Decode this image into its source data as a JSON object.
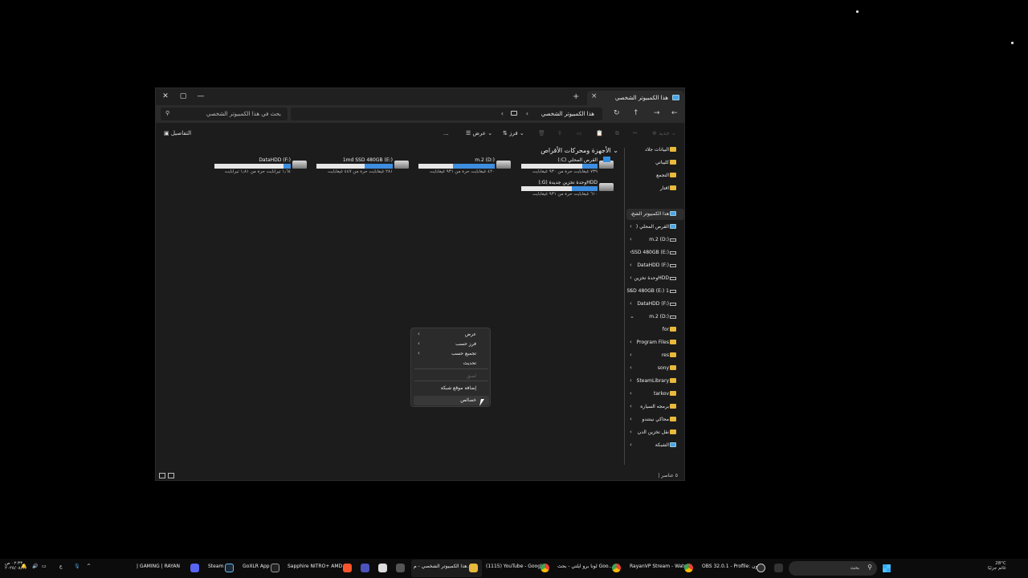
{
  "window": {
    "tab_title": "هذا الكمبيوتر الشخصي",
    "new_tab": "+",
    "breadcrumb": "هذا الكمبيوتر الشخصي",
    "search_placeholder": "بحث في هذا الكمبيوتر الشخصي",
    "details_label": "التفاصيل",
    "cmd": {
      "new_label": "جديد",
      "sort_label": "فرز",
      "view_label": "عرض",
      "more_label": "..."
    },
    "status_text": "٥ عناصر"
  },
  "content": {
    "group_header": "الأجهزة ومحركات الأقراص",
    "drives": [
      {
        "name": "القرص المحلي (C:)",
        "free": "٧٣٩ غيغابايت حرة من ٩٣٠ غيغابايت",
        "used_fraction": 0.2,
        "icon": "windows-drive-icon"
      },
      {
        "name": "m.2 (D:)",
        "free": "٤٢٠ غيغابايت حرة من ٩٣١ غيغابايت",
        "used_fraction": 0.55,
        "icon": "drive-icon"
      },
      {
        "name": "1md SSD 480GB (E:)",
        "free": "٢٨١ غيغابايت حرة من ٤٤٧ غيغابايت",
        "used_fraction": 0.37,
        "icon": "drive-icon"
      },
      {
        "name": "DataHDD (F:)",
        "free": "١٫٦٤ تيرابايت حرة من ١٫٨١ تيرابايت",
        "used_fraction": 0.1,
        "icon": "drive-icon"
      },
      {
        "name": "HDDوحدة تخزين جديدة (G:)",
        "free": "٦١٠ غيغابايت حرة من ٩٣١ غيغابايت",
        "used_fraction": 0.34,
        "icon": "drive-icon"
      }
    ]
  },
  "navpane": {
    "items": [
      {
        "label": "البيانات جلاد",
        "type": "folder",
        "chevron": ""
      },
      {
        "label": "كليباتي",
        "type": "folder",
        "chevron": ""
      },
      {
        "label": "التجمع",
        "type": "folder",
        "chevron": ""
      },
      {
        "label": "افتار",
        "type": "folder",
        "chevron": ""
      },
      {
        "label": "هذا الكمبيوتر الشخ",
        "type": "pc",
        "chevron": "⌄"
      },
      {
        "label": "القرص المحلي (",
        "type": "windrive",
        "chevron": "›"
      },
      {
        "label": "m.2 (D:)",
        "type": "drive",
        "chevron": "›"
      },
      {
        "label": "SSD 480GB (E:)",
        "type": "drive",
        "chevron": "›"
      },
      {
        "label": "DataHDD (F:)",
        "type": "drive",
        "chevron": "›"
      },
      {
        "label": "HDDوحدة تخزين",
        "type": "drive",
        "chevron": "›"
      },
      {
        "label": "SSD 480GB (E:) 1",
        "type": "drive",
        "chevron": "›"
      },
      {
        "label": "DataHDD (F:)",
        "type": "drive",
        "chevron": "›"
      },
      {
        "label": "m.2 (D:)",
        "type": "drive",
        "chevron": "⌄"
      },
      {
        "label": "for",
        "type": "folder",
        "chevron": ""
      },
      {
        "label": "Program Files",
        "type": "folder",
        "chevron": "›"
      },
      {
        "label": "res",
        "type": "folder",
        "chevron": "›"
      },
      {
        "label": "sony",
        "type": "folder",
        "chevron": "›"
      },
      {
        "label": "SteamLibrary",
        "type": "folder",
        "chevron": "›"
      },
      {
        "label": "tarkov",
        "type": "folder",
        "chevron": "›"
      },
      {
        "label": "برمجه السياره",
        "type": "folder",
        "chevron": "›"
      },
      {
        "label": "محاكي نينتندو",
        "type": "folder",
        "chevron": "›"
      },
      {
        "label": "نقل تخزين الدن",
        "type": "folder",
        "chevron": "›"
      },
      {
        "label": "الشبكة",
        "type": "network",
        "chevron": "›"
      }
    ]
  },
  "context_menu": {
    "items": [
      {
        "label": "عرض",
        "submenu": true,
        "disabled": false
      },
      {
        "label": "فرز حسب",
        "submenu": true,
        "disabled": false
      },
      {
        "label": "تجميع حسب",
        "submenu": true,
        "disabled": false
      },
      {
        "label": "تحديث",
        "submenu": false,
        "disabled": false
      },
      {
        "label": "لصق",
        "submenu": false,
        "disabled": true
      },
      {
        "label": "إضافة موقع شبكة",
        "submenu": false,
        "disabled": false
      },
      {
        "label": "خصائص",
        "submenu": false,
        "disabled": false
      }
    ]
  },
  "taskbar": {
    "search_placeholder": "بحث",
    "apps": [
      {
        "label": "هذا الكمبيوتر الشخصي - م..."
      },
      {
        "label": "(1115) YouTube - Google"
      },
      {
        "label": "لونا برو ايلتي - بحث Goo..."
      },
      {
        "label": "RayanVP Stream - Watc..."
      },
      {
        "label": "OBS 32.0.1 - Profile: بدون"
      },
      {
        "label": "Sapphire NITRO+ AMD"
      },
      {
        "label": "GoXLR App"
      },
      {
        "label": "Steam"
      },
      {
        "label": "| GAMING | RAYAN"
      }
    ],
    "clock_time": "٠٢:٣٣ ص",
    "clock_date": "٢٠٢٥/٠٨/١٧",
    "weather_temp": "28°C",
    "weather_desc": "غائم جزئيًا",
    "lang": "ع"
  }
}
